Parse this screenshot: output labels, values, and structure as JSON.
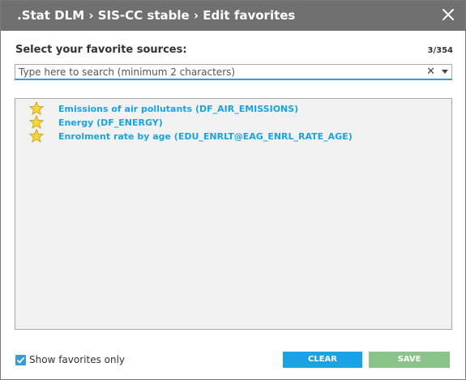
{
  "dialog": {
    "title": ".Stat DLM › SIS-CC stable › Edit favorites",
    "close_icon": "close-icon",
    "colors": {
      "titlebar": "#707070",
      "link": "#1aa3e0",
      "clear_button": "#19a3e6",
      "save_button": "#8bc48a",
      "accent": "#3a9bd8"
    }
  },
  "sources": {
    "label": "Select your favorite sources:",
    "count": "3/354",
    "search_placeholder": "Type here to search (minimum 2 characters)",
    "clear_icon": "clear-x-icon",
    "dropdown_icon": "chevron-down-icon"
  },
  "favorites": [
    {
      "label": "Emissions of air pollutants (DF_AIR_EMISSIONS)",
      "icon": "star-icon"
    },
    {
      "label": "Energy (DF_ENERGY)",
      "icon": "star-icon"
    },
    {
      "label": "Enrolment rate by age (EDU_ENRLT@EAG_ENRL_RATE_AGE)",
      "icon": "star-icon"
    }
  ],
  "footer": {
    "show_favorites_only_label": "Show favorites only",
    "show_favorites_only_checked": true,
    "clear_label": "CLEAR",
    "save_label": "SAVE"
  }
}
